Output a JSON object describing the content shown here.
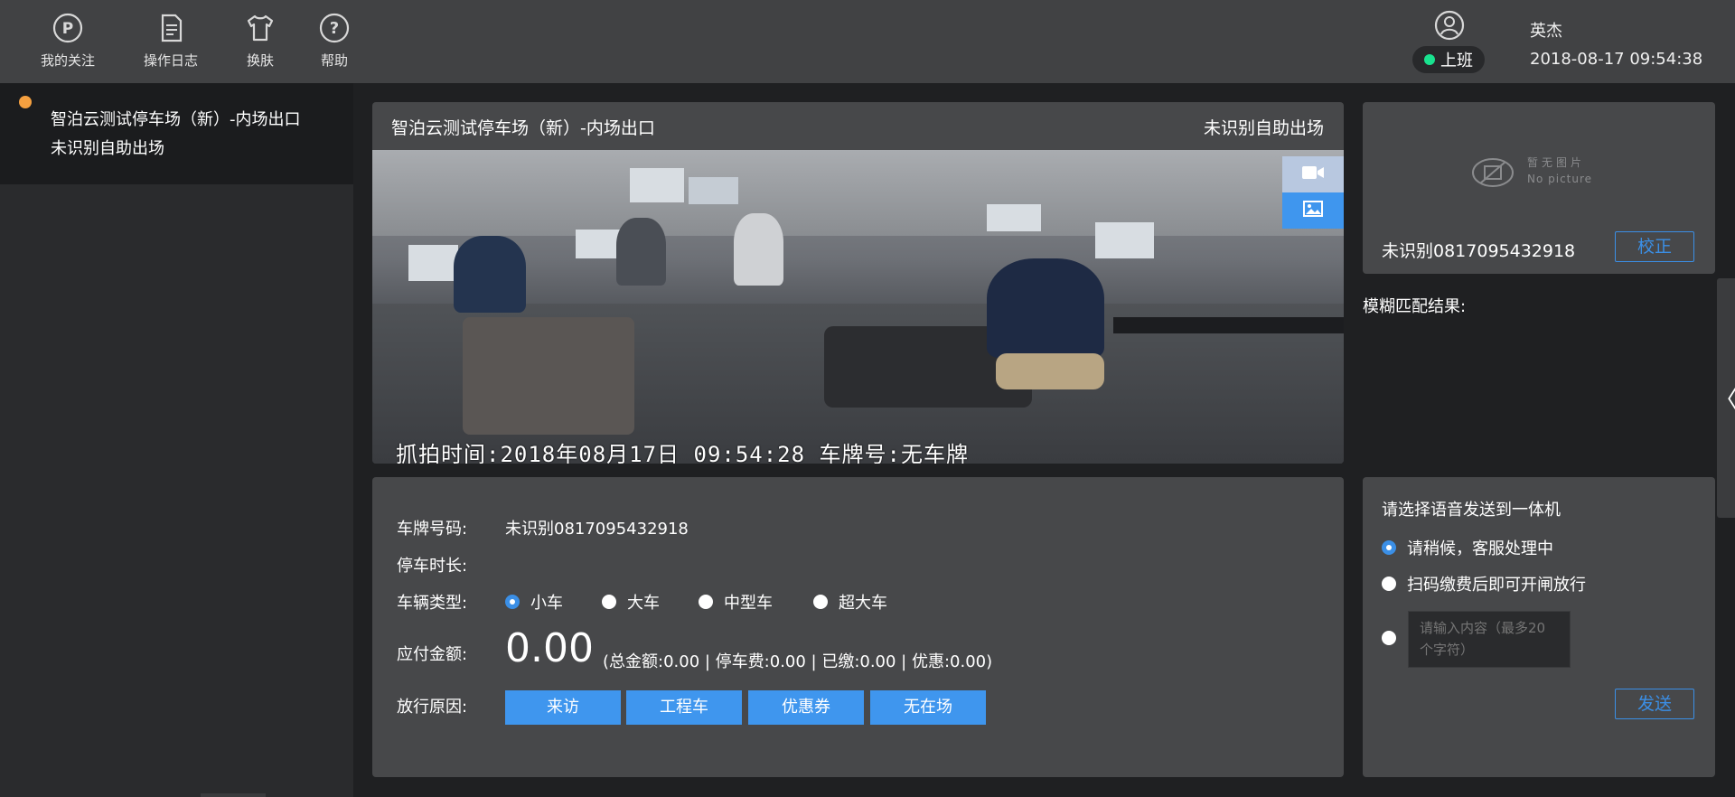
{
  "nav": {
    "items": [
      {
        "label": "我的关注",
        "icon": "parking-icon"
      },
      {
        "label": "操作日志",
        "icon": "document-icon"
      },
      {
        "label": "换肤",
        "icon": "shirt-icon"
      },
      {
        "label": "帮助",
        "icon": "help-icon"
      }
    ]
  },
  "user": {
    "name": "英杰",
    "status": "上班",
    "status_color": "#19e28f",
    "datetime": "2018-08-17 09:54:38"
  },
  "sidebar": {
    "entries": [
      {
        "title": "智泊云测试停车场（新）-内场出口",
        "subtitle": "未识别自助出场",
        "dot_color": "#f5a040"
      }
    ]
  },
  "video": {
    "title": "智泊云测试停车场（新）-内场出口",
    "status": "未识别自助出场",
    "overlay": "抓拍时间:2018年08月17日  09:54:28 车牌号:无车牌"
  },
  "plate": {
    "no_picture_cn": "暂无图片",
    "no_picture_en": "No picture",
    "text": "未识别0817095432918",
    "calibrate_label": "校正",
    "fuzzy_label": "模糊匹配结果:"
  },
  "info": {
    "plate_label": "车牌号码:",
    "plate_value": "未识别0817095432918",
    "duration_label": "停车时长:",
    "duration_value": "",
    "vehicle_type_label": "车辆类型:",
    "vehicle_types": [
      {
        "label": "小车",
        "checked": true
      },
      {
        "label": "大车",
        "checked": false
      },
      {
        "label": "中型车",
        "checked": false
      },
      {
        "label": "超大车",
        "checked": false
      }
    ],
    "amount_label": "应付金额:",
    "amount_value": "0.00",
    "amount_detail": "(总金额:0.00 | 停车费:0.00 | 已缴:0.00 | 优惠:0.00)",
    "release_reason_label": "放行原因:",
    "release_reasons": [
      "来访",
      "工程车",
      "优惠券",
      "无在场"
    ]
  },
  "voice": {
    "title": "请选择语音发送到一体机",
    "options": [
      {
        "label": "请稍候，客服处理中",
        "checked": true
      },
      {
        "label": "扫码缴费后即可开闸放行",
        "checked": false
      }
    ],
    "input_placeholder": "请输入内容（最多20个字符）",
    "send_label": "发送"
  },
  "colors": {
    "accent": "#3f96ee",
    "panel": "#47484a",
    "topbar": "#414244"
  }
}
